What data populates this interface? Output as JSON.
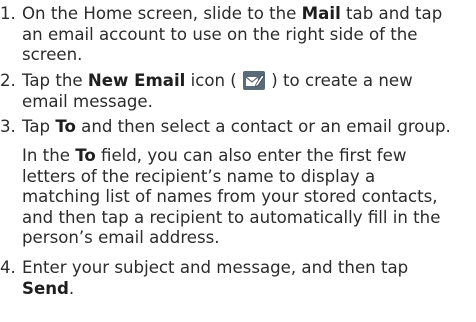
{
  "steps": [
    {
      "number": "1.",
      "lines": [
        [
          "On the Home screen, slide to the ",
          {
            "b": "Mail"
          },
          " tab and tap"
        ],
        [
          "an email account to use on the right side of the"
        ],
        [
          "screen."
        ]
      ]
    },
    {
      "number": "2.",
      "lines": [
        [
          "Tap the ",
          {
            "b": "New Email"
          },
          " icon ( ",
          {
            "icon": "new-email-icon"
          },
          " ) to create a new"
        ],
        [
          "email message."
        ]
      ]
    },
    {
      "number": "3.",
      "lines": [
        [
          "Tap ",
          {
            "b": "To"
          },
          " and then select a contact or an email group."
        ]
      ],
      "note_lines": [
        [
          "In the ",
          {
            "b": "To"
          },
          " field, you can also enter the first few"
        ],
        [
          "letters of the recipient’s name to display a"
        ],
        [
          "matching list of names from your stored contacts,"
        ],
        [
          "and then tap a recipient to automatically fill in the"
        ],
        [
          "person’s email address."
        ]
      ]
    },
    {
      "number": "4.",
      "lines": [
        [
          "Enter your subject and message, and then tap"
        ],
        [
          {
            "b": "Send"
          },
          "."
        ]
      ]
    }
  ],
  "icon_colors": {
    "tile": "#5a6b78",
    "envelope": "#ffffff",
    "pen": "#3d4a55"
  }
}
